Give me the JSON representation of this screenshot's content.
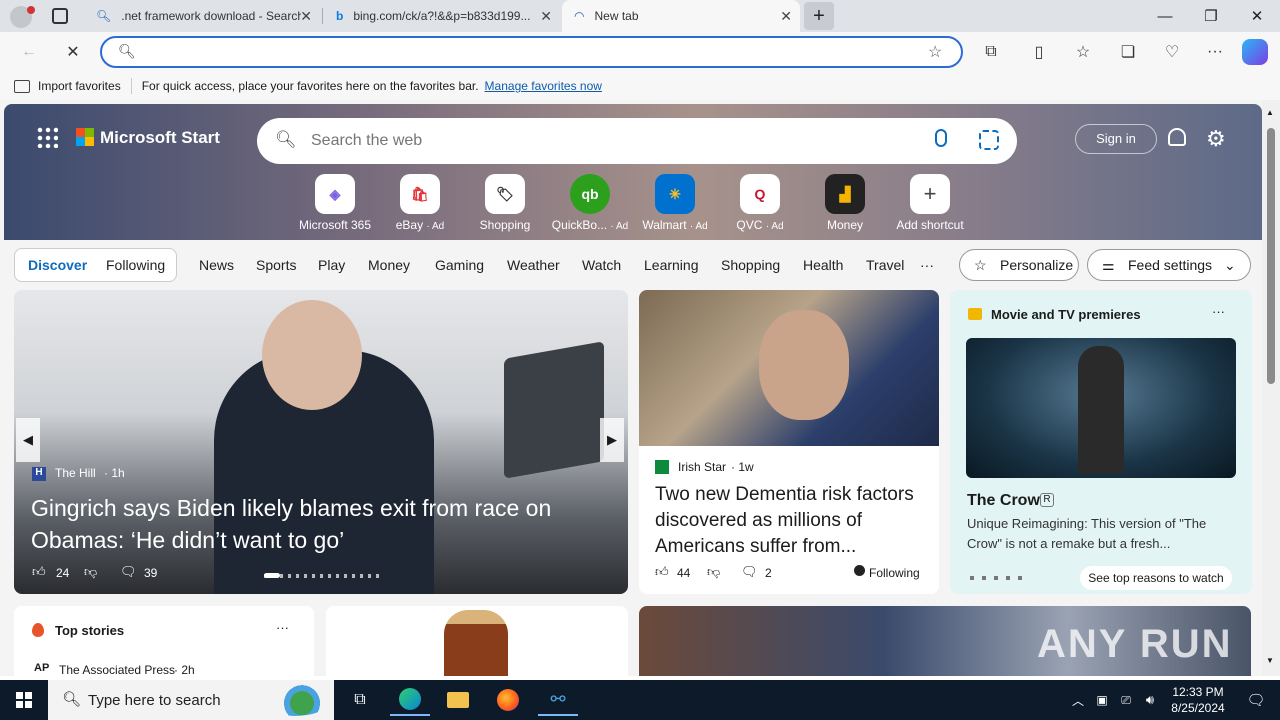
{
  "browser": {
    "tabs": [
      {
        "title": ".net framework download - Search"
      },
      {
        "title": "bing.com/ck/a?!&&p=b833d199..."
      },
      {
        "title": "New tab"
      }
    ],
    "address": {
      "value": ""
    },
    "favorites_bar": {
      "import_label": "Import favorites",
      "message": "For quick access, place your favorites here on the favorites bar.",
      "manage_link": "Manage favorites now"
    }
  },
  "page": {
    "brand": "Microsoft Start",
    "search_placeholder": "Search the web",
    "sign_in": "Sign in",
    "shortcuts": [
      {
        "label": "Microsoft 365",
        "ad": ""
      },
      {
        "label": "eBay",
        "ad": "· Ad"
      },
      {
        "label": "Shopping",
        "ad": ""
      },
      {
        "label": "QuickBo...",
        "ad": "· Ad"
      },
      {
        "label": "Walmart",
        "ad": "· Ad"
      },
      {
        "label": "QVC",
        "ad": "· Ad"
      },
      {
        "label": "Money",
        "ad": ""
      },
      {
        "label": "Add shortcut",
        "ad": ""
      }
    ],
    "nav": {
      "discover": "Discover",
      "following": "Following",
      "items": [
        "News",
        "Sports",
        "Play",
        "Money",
        "Gaming",
        "Weather",
        "Watch",
        "Learning",
        "Shopping",
        "Health",
        "Travel"
      ],
      "more": "···",
      "personalize": "Personalize",
      "feed_settings": "Feed settings"
    },
    "hero_story": {
      "source": "The Hill",
      "age": "· 1h",
      "headline": "Gingrich says Biden likely blames exit from race on Obamas: ‘He didn’t want to go’",
      "likes": "24",
      "comments": "39"
    },
    "side_story": {
      "source": "Irish Star",
      "age": "· 1w",
      "headline": "Two new Dementia risk factors discovered as millions of Americans suffer from...",
      "likes": "44",
      "comments": "2",
      "following": "Following"
    },
    "movie_card": {
      "header": "Movie and TV premieres",
      "title": "The Crow",
      "rating": "R",
      "desc": "Unique Reimagining: This version of \"The Crow\" is not a remake but a fresh...",
      "cta": "See top reasons to watch"
    },
    "top_stories": {
      "header": "Top stories",
      "first_source": "The Associated Press",
      "first_age": "· 2h"
    },
    "watermark": "ANY RUN"
  },
  "taskbar": {
    "search_placeholder": "Type here to search",
    "time": "12:33 PM",
    "date": "8/25/2024"
  },
  "colors": {
    "accent": "#0f6cbd",
    "taskbar": "#0c1a2a"
  }
}
